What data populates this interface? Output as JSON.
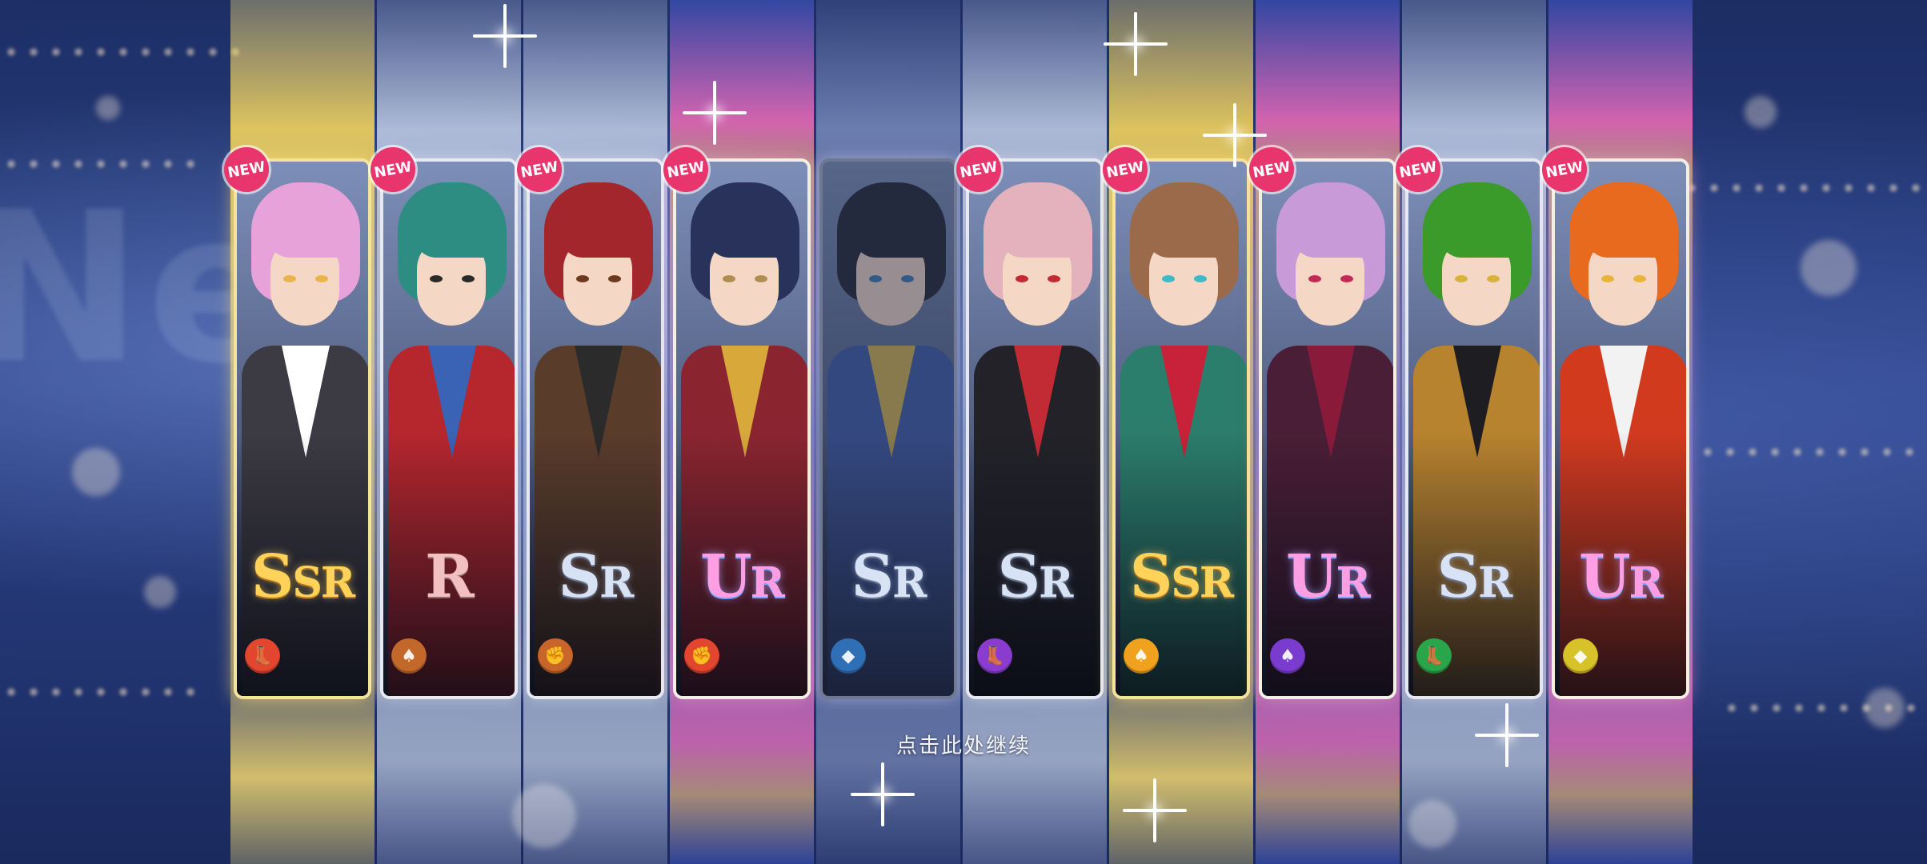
{
  "background": {
    "word": "Ne"
  },
  "continue_hint": "点击此处继续",
  "new_badge_label": "NEW",
  "cards": [
    {
      "rarity": "SSR",
      "rarity_class": "ssr",
      "frame": "gold",
      "is_new": true,
      "type_icon": "boot-icon",
      "type_color": "#e2462f",
      "hair": "#e7a2d9",
      "outfit": "#3c3a42",
      "accent": "#ffffff",
      "eye": "#e8b44c"
    },
    {
      "rarity": "R",
      "rarity_class": "r",
      "frame": "white",
      "is_new": true,
      "type_icon": "cards-icon",
      "type_color": "#c2682b",
      "hair": "#2d8d82",
      "outfit": "#b6262d",
      "accent": "#3a63b5",
      "eye": "#2a2a2a"
    },
    {
      "rarity": "SR",
      "rarity_class": "sr",
      "frame": "white",
      "is_new": true,
      "type_icon": "fist-icon",
      "type_color": "#c8652a",
      "hair": "#a3262c",
      "outfit": "#5a3c2a",
      "accent": "#2b2b2b",
      "eye": "#6b3a1e"
    },
    {
      "rarity": "UR",
      "rarity_class": "ur",
      "frame": "rainbow",
      "is_new": true,
      "type_icon": "fist-icon",
      "type_color": "#e2462f",
      "hair": "#28325a",
      "outfit": "#8a2530",
      "accent": "#d8a93a",
      "eye": "#b08d50"
    },
    {
      "rarity": "SR",
      "rarity_class": "sr",
      "frame": "dark",
      "is_new": false,
      "type_icon": "shield-icon",
      "type_color": "#2f6fb5",
      "hair": "#1f2430",
      "outfit": "#3f5aa8",
      "accent": "#d8b44a",
      "eye": "#3a7bb5"
    },
    {
      "rarity": "SR",
      "rarity_class": "sr",
      "frame": "white",
      "is_new": true,
      "type_icon": "boot-icon",
      "type_color": "#8a3ccf",
      "hair": "#e4b2bd",
      "outfit": "#222228",
      "accent": "#c22a34",
      "eye": "#c22a34"
    },
    {
      "rarity": "SSR",
      "rarity_class": "ssr",
      "frame": "gold",
      "is_new": true,
      "type_icon": "cards-icon",
      "type_color": "#f0a21e",
      "hair": "#9a6a4a",
      "outfit": "#2b7d6c",
      "accent": "#c7223a",
      "eye": "#3fb8c7"
    },
    {
      "rarity": "UR",
      "rarity_class": "ur",
      "frame": "rainbow",
      "is_new": true,
      "type_icon": "cards-icon",
      "type_color": "#7a3ccf",
      "hair": "#c89ad8",
      "outfit": "#4a1e36",
      "accent": "#8a1a3a",
      "eye": "#c22a55"
    },
    {
      "rarity": "SR",
      "rarity_class": "sr",
      "frame": "white",
      "is_new": true,
      "type_icon": "boot-icon",
      "type_color": "#2aa64a",
      "hair": "#3a9a2a",
      "outfit": "#b8832e",
      "accent": "#1e1e22",
      "eye": "#d8b23a"
    },
    {
      "rarity": "UR",
      "rarity_class": "ur",
      "frame": "rainbow",
      "is_new": true,
      "type_icon": "shield-icon",
      "type_color": "#d8c22a",
      "hair": "#e86a1e",
      "outfit": "#d23a1e",
      "accent": "#f2f2f2",
      "eye": "#e8b43a"
    }
  ]
}
